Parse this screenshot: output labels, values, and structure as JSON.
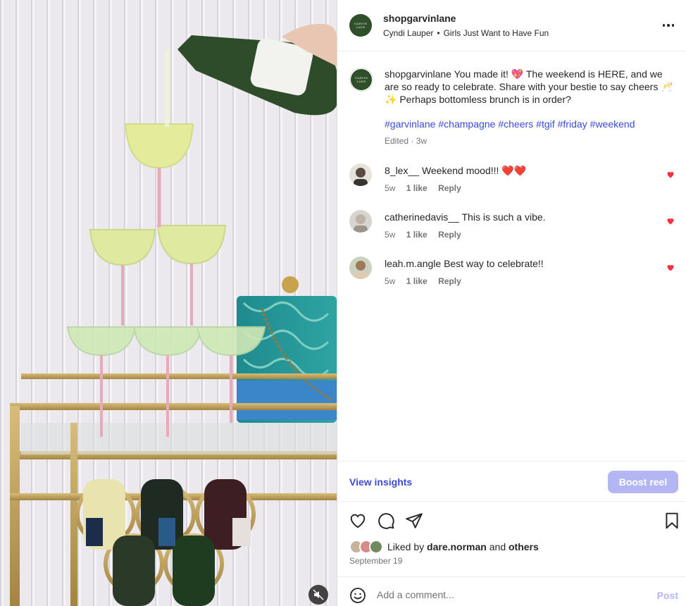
{
  "post": {
    "username": "shopgarvinlane",
    "avatar_text": "GARVIN LANE",
    "audio_artist": "Cyndi Lauper",
    "audio_separator": "•",
    "audio_track": "Girls Just Want to Have Fun"
  },
  "caption": {
    "username": "shopgarvinlane",
    "text": "You made it! 💖 The weekend is HERE, and we are so ready to celebrate. Share with your bestie to say cheers 🥂✨ Perhaps bottomless brunch is in order?",
    "hashtags": [
      "#garvinlane",
      "#champagne",
      "#cheers",
      "#tgif",
      "#friday",
      "#weekend"
    ],
    "edited": "Edited · 3w"
  },
  "comments": [
    {
      "username": "8_lex__",
      "text": "Weekend mood!!! ❤️❤️",
      "age": "5w",
      "likes": "1 like",
      "reply": "Reply",
      "avatar_color": "#8a7f78"
    },
    {
      "username": "catherinedavis__",
      "text": "This is such a vibe.",
      "age": "5w",
      "likes": "1 like",
      "reply": "Reply",
      "avatar_color": "#c9c4bd"
    },
    {
      "username": "leah.m.angle",
      "text": "Best way to celebrate!!",
      "age": "5w",
      "likes": "1 like",
      "reply": "Reply",
      "avatar_color": "#a58a6e"
    }
  ],
  "insights": {
    "view_label": "View insights",
    "boost_label": "Boost reel"
  },
  "likes": {
    "prefix": "Liked by",
    "user": "dare.norman",
    "joiner": "and",
    "others": "others"
  },
  "date": "September 19",
  "add_comment": {
    "placeholder": "Add a comment...",
    "post_label": "Post"
  },
  "colors": {
    "link": "#3b4bd8",
    "heart": "#ff3040",
    "boost_bg": "#b3b6f3",
    "brand_green": "#2f4f2a"
  },
  "icons": {
    "more": "more-horizontal-icon",
    "like": "heart-outline-icon",
    "comment": "comment-bubble-icon",
    "share": "paper-plane-icon",
    "save": "bookmark-icon",
    "emoji": "emoji-smile-icon",
    "mute": "speaker-muted-icon",
    "comment_like": "heart-filled-icon"
  }
}
